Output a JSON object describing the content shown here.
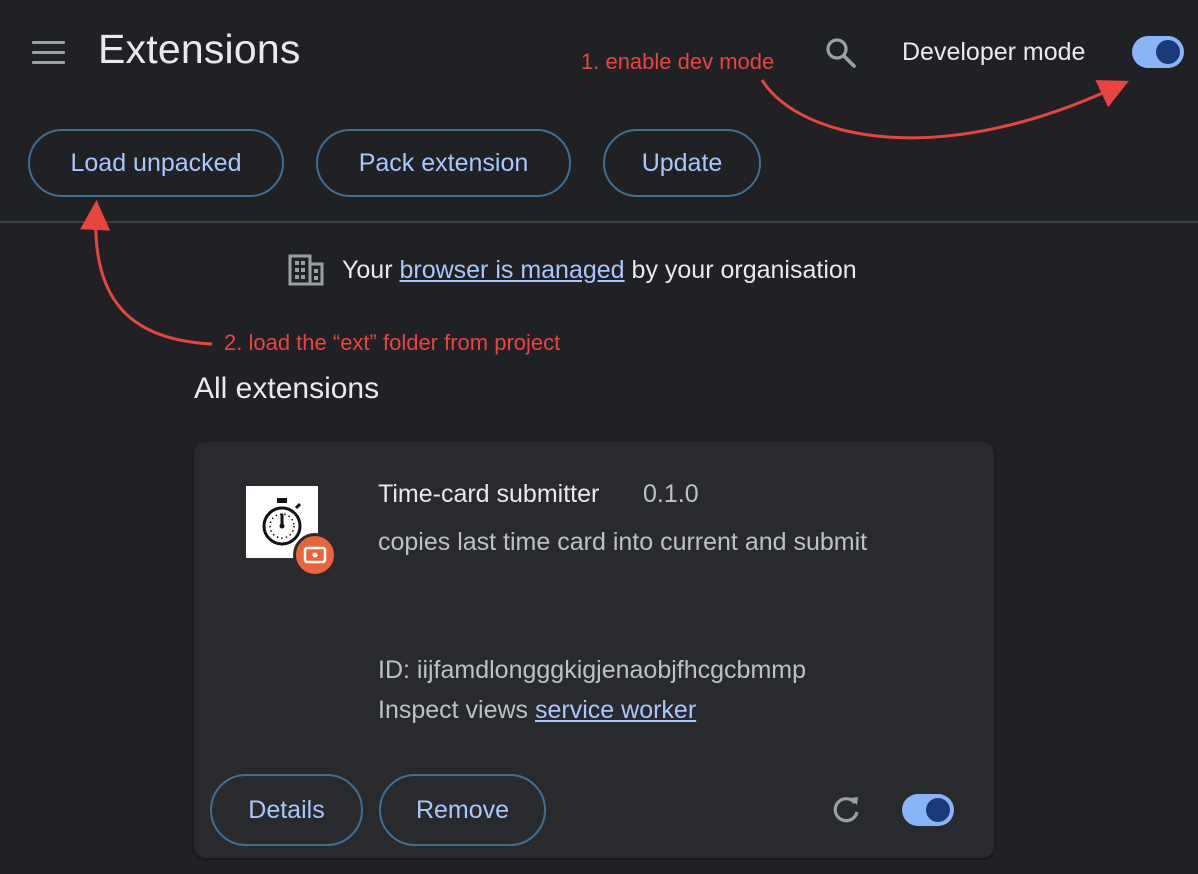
{
  "header": {
    "title": "Extensions",
    "developer_mode_label": "Developer mode",
    "developer_mode_enabled": true
  },
  "toolbar": {
    "load_unpacked_label": "Load unpacked",
    "pack_extension_label": "Pack extension",
    "update_label": "Update"
  },
  "managed_notice": {
    "prefix": "Your",
    "link": "browser is managed",
    "suffix": "by your organisation"
  },
  "annotations": {
    "step1": "1. enable dev mode",
    "step2": "2. load the “ext” folder from project",
    "color": "#e8453c"
  },
  "section": {
    "title": "All extensions"
  },
  "extension": {
    "name": "Time-card submitter",
    "version": "0.1.0",
    "description": "copies last time card into current and submit",
    "id_text": "ID: iijfamdlongggkigjenaobjfhcgcbmmp",
    "inspect_prefix": "Inspect views",
    "inspect_link": "service worker",
    "details_label": "Details",
    "remove_label": "Remove",
    "enabled": true,
    "icon": "stopwatch-icon",
    "badge_icon": "unpacked-badge-icon"
  },
  "colors": {
    "background": "#202124",
    "card": "#292a2d",
    "accent": "#a8c7fa",
    "toggle_on": "#8ab4f8",
    "annotation": "#e8453c"
  }
}
